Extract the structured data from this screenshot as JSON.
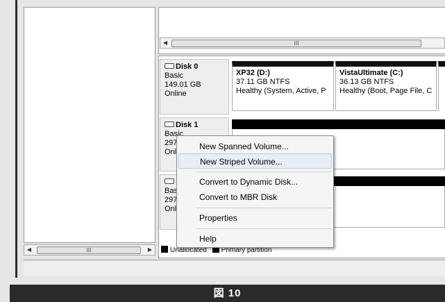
{
  "disks": [
    {
      "name": "Disk 0",
      "type": "Basic",
      "size": "149.01 GB",
      "status": "Online",
      "partitions": [
        {
          "name": "XP32  (D:)",
          "size_fs": "37.11 GB NTFS",
          "health": "Healthy (System, Active, P"
        },
        {
          "name": "VistaUltimate  (C:)",
          "size_fs": "36.13 GB NTFS",
          "health": "Healthy (Boot, Page File, C"
        }
      ]
    },
    {
      "name": "Disk 1",
      "type": "Basic",
      "size": "297",
      "status": "Online"
    },
    {
      "type": "Basic",
      "size": "297",
      "status": "Online"
    }
  ],
  "context_menu": {
    "items": [
      {
        "label": "New Spanned Volume..."
      },
      {
        "label": "New Striped Volume...",
        "highlighted": true
      },
      {
        "label": "Convert to Dynamic Disk..."
      },
      {
        "label": "Convert to MBR Disk"
      },
      {
        "label": "Properties"
      },
      {
        "label": "Help"
      }
    ]
  },
  "legend": {
    "unallocated": "Unallocated",
    "primary": "Primary partition"
  },
  "scroll_thumb_grip": "III",
  "caption": "図 10"
}
